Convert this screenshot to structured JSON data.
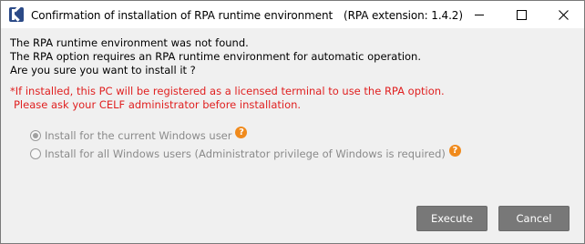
{
  "window": {
    "title": "Confirmation of installation of RPA runtime environment　(RPA extension: 1.4.2)"
  },
  "message": {
    "lines": [
      "The RPA runtime environment was not found.",
      "The RPA option requires an RPA runtime environment for automatic operation.",
      "Are you sure you want to install it ?"
    ]
  },
  "warning": {
    "lines": [
      "*If installed, this PC will be registered as a licensed terminal to use the RPA option.",
      "Please ask your CELF administrator before installation."
    ],
    "color": "#e02020"
  },
  "options": [
    {
      "label": "Install for the current Windows user",
      "selected": true,
      "help_icon": "question-icon"
    },
    {
      "label": "Install for all Windows users (Administrator privilege of Windows is required)",
      "selected": false,
      "help_icon": "question-icon"
    }
  ],
  "help_glyph": "?",
  "buttons": {
    "execute_label": "Execute",
    "cancel_label": "Cancel"
  },
  "colors": {
    "help_icon": "#f08a1c",
    "button_bg": "#787878"
  }
}
